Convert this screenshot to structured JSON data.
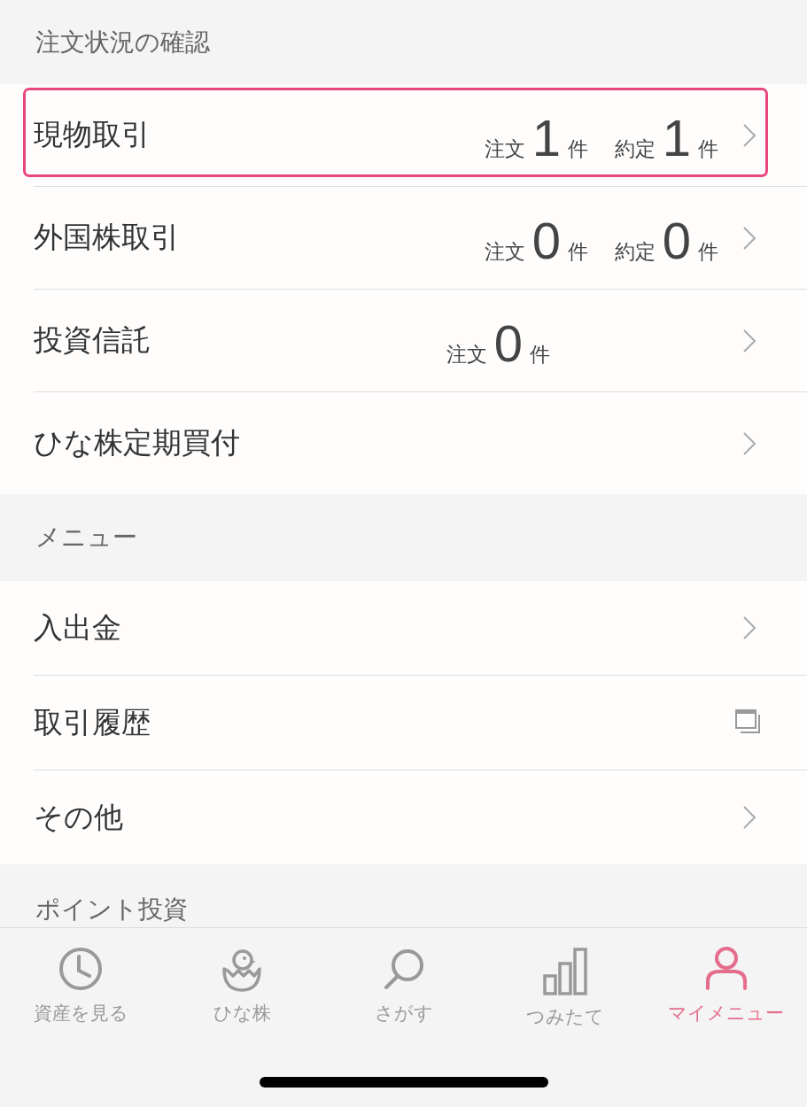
{
  "sections": [
    {
      "title": "注文状況の確認",
      "items": [
        {
          "label": "現物取引",
          "highlighted": true,
          "kind": "chevron",
          "counts": [
            {
              "label": "注文",
              "value": "1",
              "unit": "件"
            },
            {
              "label": "約定",
              "value": "1",
              "unit": "件"
            }
          ]
        },
        {
          "label": "外国株取引",
          "highlighted": false,
          "kind": "chevron",
          "counts": [
            {
              "label": "注文",
              "value": "0",
              "unit": "件"
            },
            {
              "label": "約定",
              "value": "0",
              "unit": "件"
            }
          ]
        },
        {
          "label": "投資信託",
          "highlighted": false,
          "kind": "chevron",
          "counts": [
            {
              "label": "注文",
              "value": "0",
              "unit": "件"
            }
          ]
        },
        {
          "label": "ひな株定期買付",
          "highlighted": false,
          "kind": "chevron"
        }
      ]
    },
    {
      "title": "メニュー",
      "items": [
        {
          "label": "入出金",
          "highlighted": false,
          "kind": "chevron"
        },
        {
          "label": "取引履歴",
          "highlighted": false,
          "kind": "window"
        },
        {
          "label": "その他",
          "highlighted": false,
          "kind": "chevron"
        }
      ]
    },
    {
      "title": "ポイント投資"
    }
  ],
  "tab_bar": [
    {
      "label": "資産を見る",
      "selected": false
    },
    {
      "label": "ひな株",
      "selected": false
    },
    {
      "label": "さがす",
      "selected": false
    },
    {
      "label": "つみたて",
      "selected": false
    },
    {
      "label": "マイメニュー",
      "selected": true
    }
  ]
}
